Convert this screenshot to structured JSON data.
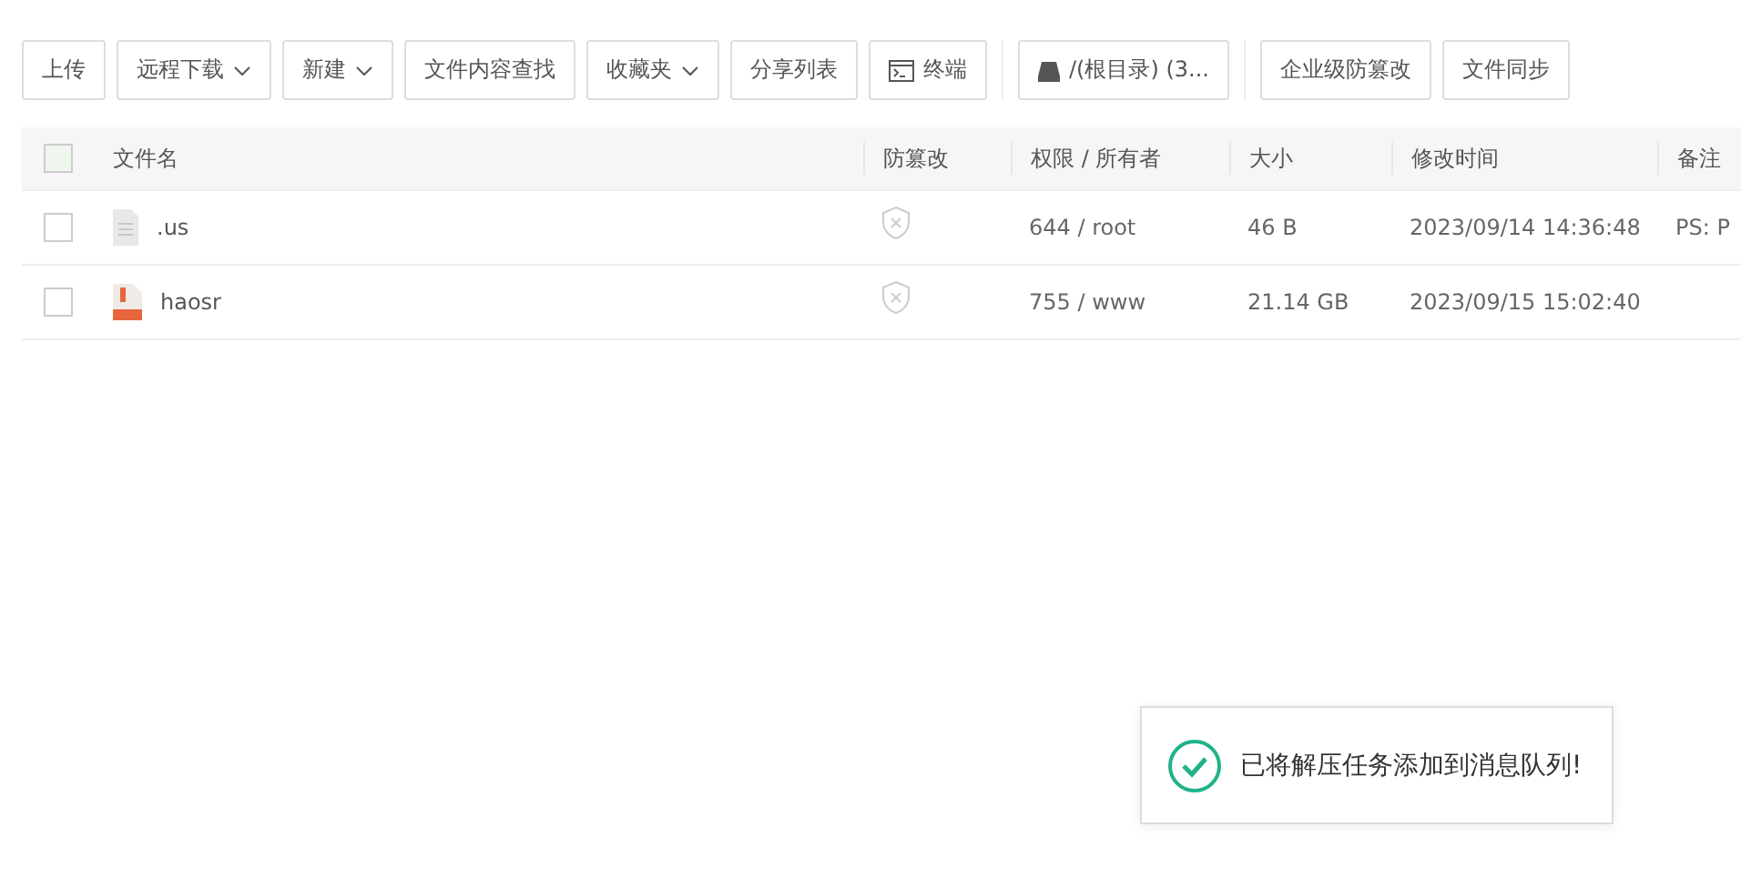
{
  "toolbar": [
    {
      "label": "上传",
      "kind": "plain"
    },
    {
      "label": "远程下载",
      "kind": "dropdown"
    },
    {
      "label": "新建",
      "kind": "dropdown"
    },
    {
      "label": "文件内容查找",
      "kind": "plain"
    },
    {
      "label": "收藏夹",
      "kind": "dropdown"
    },
    {
      "label": "分享列表",
      "kind": "plain"
    },
    {
      "label": "终端",
      "kind": "terminal"
    },
    {
      "label": "/(根目录) (3...",
      "kind": "disk"
    },
    {
      "label": "企业级防篡改",
      "kind": "plain"
    },
    {
      "label": "文件同步",
      "kind": "plain"
    }
  ],
  "table": {
    "select_all": {
      "checked": false
    },
    "columns": [
      "文件名",
      "防篡改",
      "权限 / 所有者",
      "大小",
      "修改时间",
      "备注"
    ],
    "rows": [
      {
        "checked": false,
        "kind": "text",
        "name": ".us",
        "tamper_protected": false,
        "permission": "644 / root",
        "size": "46 B",
        "modified": "2023/09/14 14:36:48",
        "note": "PS: P"
      },
      {
        "checked": false,
        "kind": "archive",
        "name": "haosr",
        "tamper_protected": false,
        "permission": "755 / www",
        "size": "21.14 GB",
        "modified": "2023/09/15 15:02:40"
      }
    ]
  },
  "toast": {
    "message": "已将解压任务添加到消息队列!",
    "kind": "success"
  }
}
